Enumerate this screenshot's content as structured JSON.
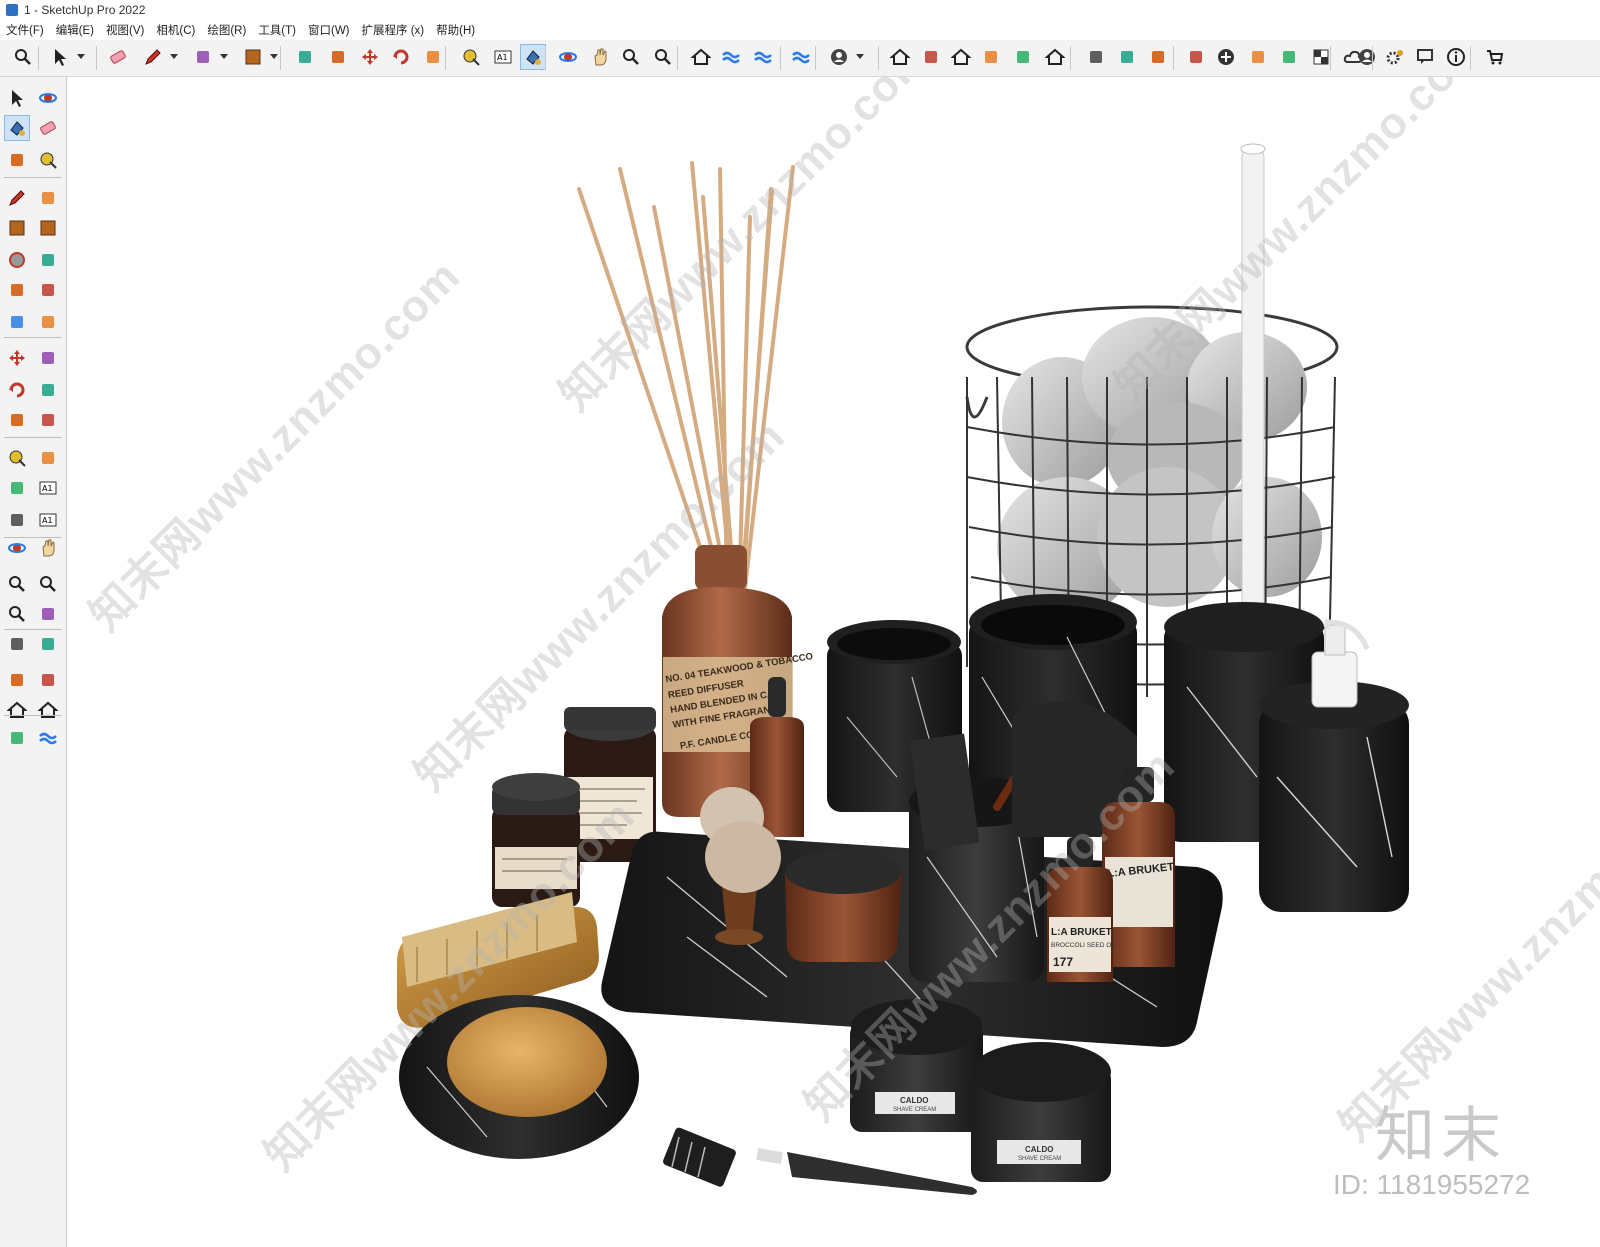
{
  "window": {
    "title": "1 - SketchUp Pro 2022"
  },
  "menu": [
    {
      "label": "文件(F)"
    },
    {
      "label": "编辑(E)"
    },
    {
      "label": "视图(V)"
    },
    {
      "label": "相机(C)"
    },
    {
      "label": "绘图(R)"
    },
    {
      "label": "工具(T)"
    },
    {
      "label": "窗口(W)"
    },
    {
      "label": "扩展程序 (x)"
    },
    {
      "label": "帮助(H)"
    }
  ],
  "toolbar": {
    "icons": [
      "zoom-icon",
      "select-icon",
      "eraser-icon",
      "pencil-icon",
      "arc-icon",
      "rectangle-icon",
      "push-pull-icon",
      "follow-me-icon",
      "move-icon",
      "rotate-icon",
      "scale-icon",
      "tape-measure-icon",
      "text-icon",
      "paint-bucket-icon",
      "orbit-icon",
      "pan-icon",
      "zoom-window-icon",
      "zoom-extents-icon",
      "warehouse-icon",
      "extension-icon",
      "layers-icon",
      "sandbox-icon",
      "account-icon",
      "home-iso-icon",
      "front-view-icon",
      "house-icon",
      "top-view-icon",
      "back-view-icon",
      "house-outline-icon",
      "section-icon",
      "component-icon",
      "scenes-icon",
      "camera-icon",
      "add-icon",
      "styles-icon",
      "materials-icon",
      "checker-icon",
      "cloud-icon",
      "settings-icon",
      "chat-icon",
      "info-icon",
      "cart-icon",
      "user-icon"
    ],
    "active_icon": "paint-bucket-icon"
  },
  "sidebar": {
    "icons": [
      "select-icon",
      "orbit-icon",
      "paint-bucket-icon",
      "eraser-icon",
      "component-icon",
      "tape-measure-icon",
      "pencil-icon",
      "freehand-icon",
      "rectangle-icon",
      "rotated-rectangle-icon",
      "circle-icon",
      "polygon-icon",
      "arc-icon",
      "pie-icon",
      "arc3-icon",
      "sector-icon",
      "move-icon",
      "push-pull-icon",
      "rotate-icon",
      "follow-me-icon",
      "scale-icon",
      "offset-icon",
      "tape-measure-icon",
      "dimension-icon",
      "protractor-icon",
      "text-icon",
      "axes-icon",
      "3d-text-icon",
      "orbit-icon",
      "pan-icon",
      "zoom-icon",
      "zoom-window-icon",
      "zoom-extents-icon",
      "previous-icon",
      "position-camera-icon",
      "look-around-icon",
      "walk-icon",
      "section-plane-icon",
      "warehouse-icon",
      "extension-warehouse-icon",
      "layout-icon",
      "sandbox-icon"
    ],
    "active_icon": "paint-bucket-icon"
  },
  "scene": {
    "reed_diffuser_label": [
      "NO. 04 TEAKWOOD & TOBACCO",
      "REED DIFFUSER",
      "HAND BLENDED IN CA",
      "WITH FINE FRAGRANCE",
      "P.F. CANDLE CO."
    ],
    "bottle_label_1": "L:A BRUKET",
    "bottle_label_2": "L:A BRUKET",
    "bottle_sub_2": "BROCCOLI SEED OIL",
    "bottle_num_2": "177",
    "jar_label_1": "CALDO",
    "jar_sub_1": "SHAVE CREAM",
    "jar_label_2": "CALDO",
    "jar_sub_2": "SHAVE CREAM"
  },
  "watermark": {
    "text": "知末网www.znzmo.com",
    "logo": "知末",
    "id": "ID: 1181955272"
  }
}
